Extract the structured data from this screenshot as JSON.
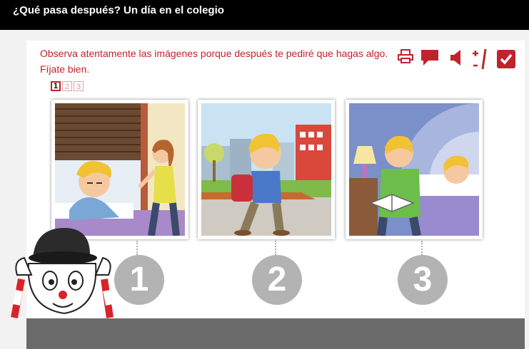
{
  "header": {
    "title": "¿Qué pasa después? Un día en el colegio"
  },
  "instructions": "Observa atentamente las imágenes porque después te pediré que hagas algo. Fíjate bien.",
  "pager": {
    "pages": [
      "1",
      "2",
      "3"
    ],
    "current": "1"
  },
  "toolbar": {
    "icons": [
      "print-icon",
      "speech-bubble-icon",
      "speaker-icon",
      "text-size-icon",
      "check-icon"
    ]
  },
  "panels": [
    {
      "number": "1",
      "scene": "boy-waking-up-in-bed"
    },
    {
      "number": "2",
      "scene": "boy-walking-to-school"
    },
    {
      "number": "3",
      "scene": "father-reading-to-boy-in-bed"
    }
  ],
  "colors": {
    "accent": "#c0232c",
    "title_bg": "#000000",
    "number_circle": "#b3b3b3",
    "bottom_bar": "#6b6b6b"
  }
}
